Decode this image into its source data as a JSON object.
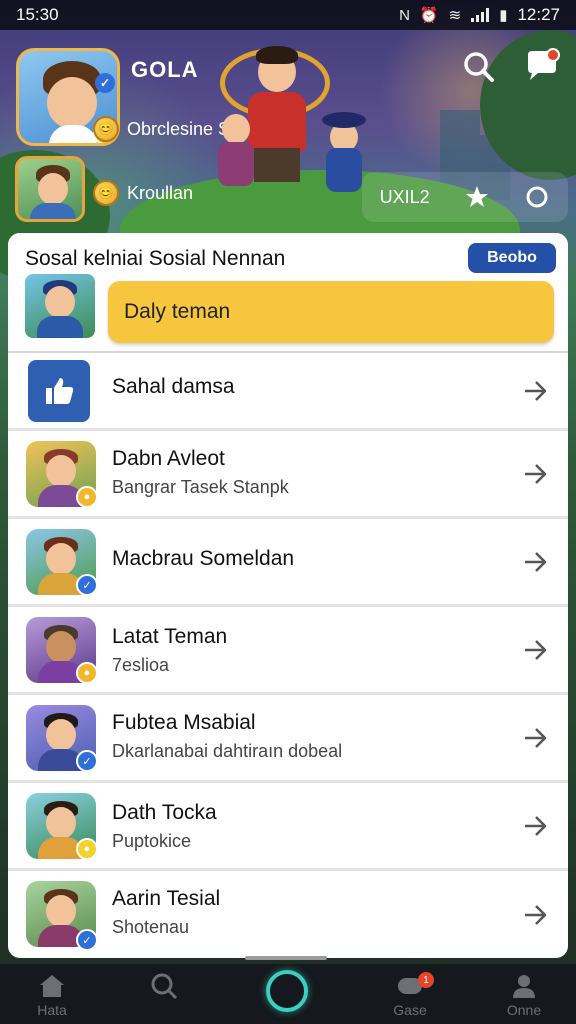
{
  "status_bar": {
    "time_left": "15:30",
    "time_right": "12:27"
  },
  "header": {
    "title": "GOLA",
    "subtitle": "Obrclesine Sebsen",
    "secondary_label": "Kroullan",
    "stats_label": "UXIL2"
  },
  "panel": {
    "title": "Sosal kelniai Sosial Nennan",
    "action_button": "Beobo",
    "featured_label": "Daly teman",
    "rows": [
      {
        "name": "Sahal damsa",
        "sub": "",
        "icon": "thumbs-up-icon"
      },
      {
        "name": "Dabn Avleot",
        "sub": "Bangrar Tasek Stanpk",
        "icon": "avatar"
      },
      {
        "name": "Macbrau Someldan",
        "sub": "",
        "icon": "avatar"
      },
      {
        "name": "Latat Teman",
        "sub": "7eslioa",
        "icon": "avatar"
      },
      {
        "name": "Fubtea Msabial",
        "sub": "Dkarlanabai dahtiraın dobeal",
        "icon": "avatar"
      },
      {
        "name": "Dath Tocka",
        "sub": "Puptokice",
        "icon": "avatar"
      },
      {
        "name": "Aarin Tesial",
        "sub": "Shotenau",
        "icon": "avatar"
      }
    ]
  },
  "bottom_nav": {
    "items": [
      {
        "label": "Hata",
        "icon": "home-icon"
      },
      {
        "label": "",
        "icon": "search-icon"
      },
      {
        "label": "",
        "icon": "center-ring-icon"
      },
      {
        "label": "Gase",
        "icon": "chat-icon",
        "badge": "1"
      },
      {
        "label": "Onne",
        "icon": "profile-icon"
      }
    ]
  },
  "colors": {
    "accent_yellow": "#f6c73e",
    "accent_blue": "#2450a8",
    "notification_red": "#e8442a",
    "center_ring": "#3ad0c0"
  }
}
